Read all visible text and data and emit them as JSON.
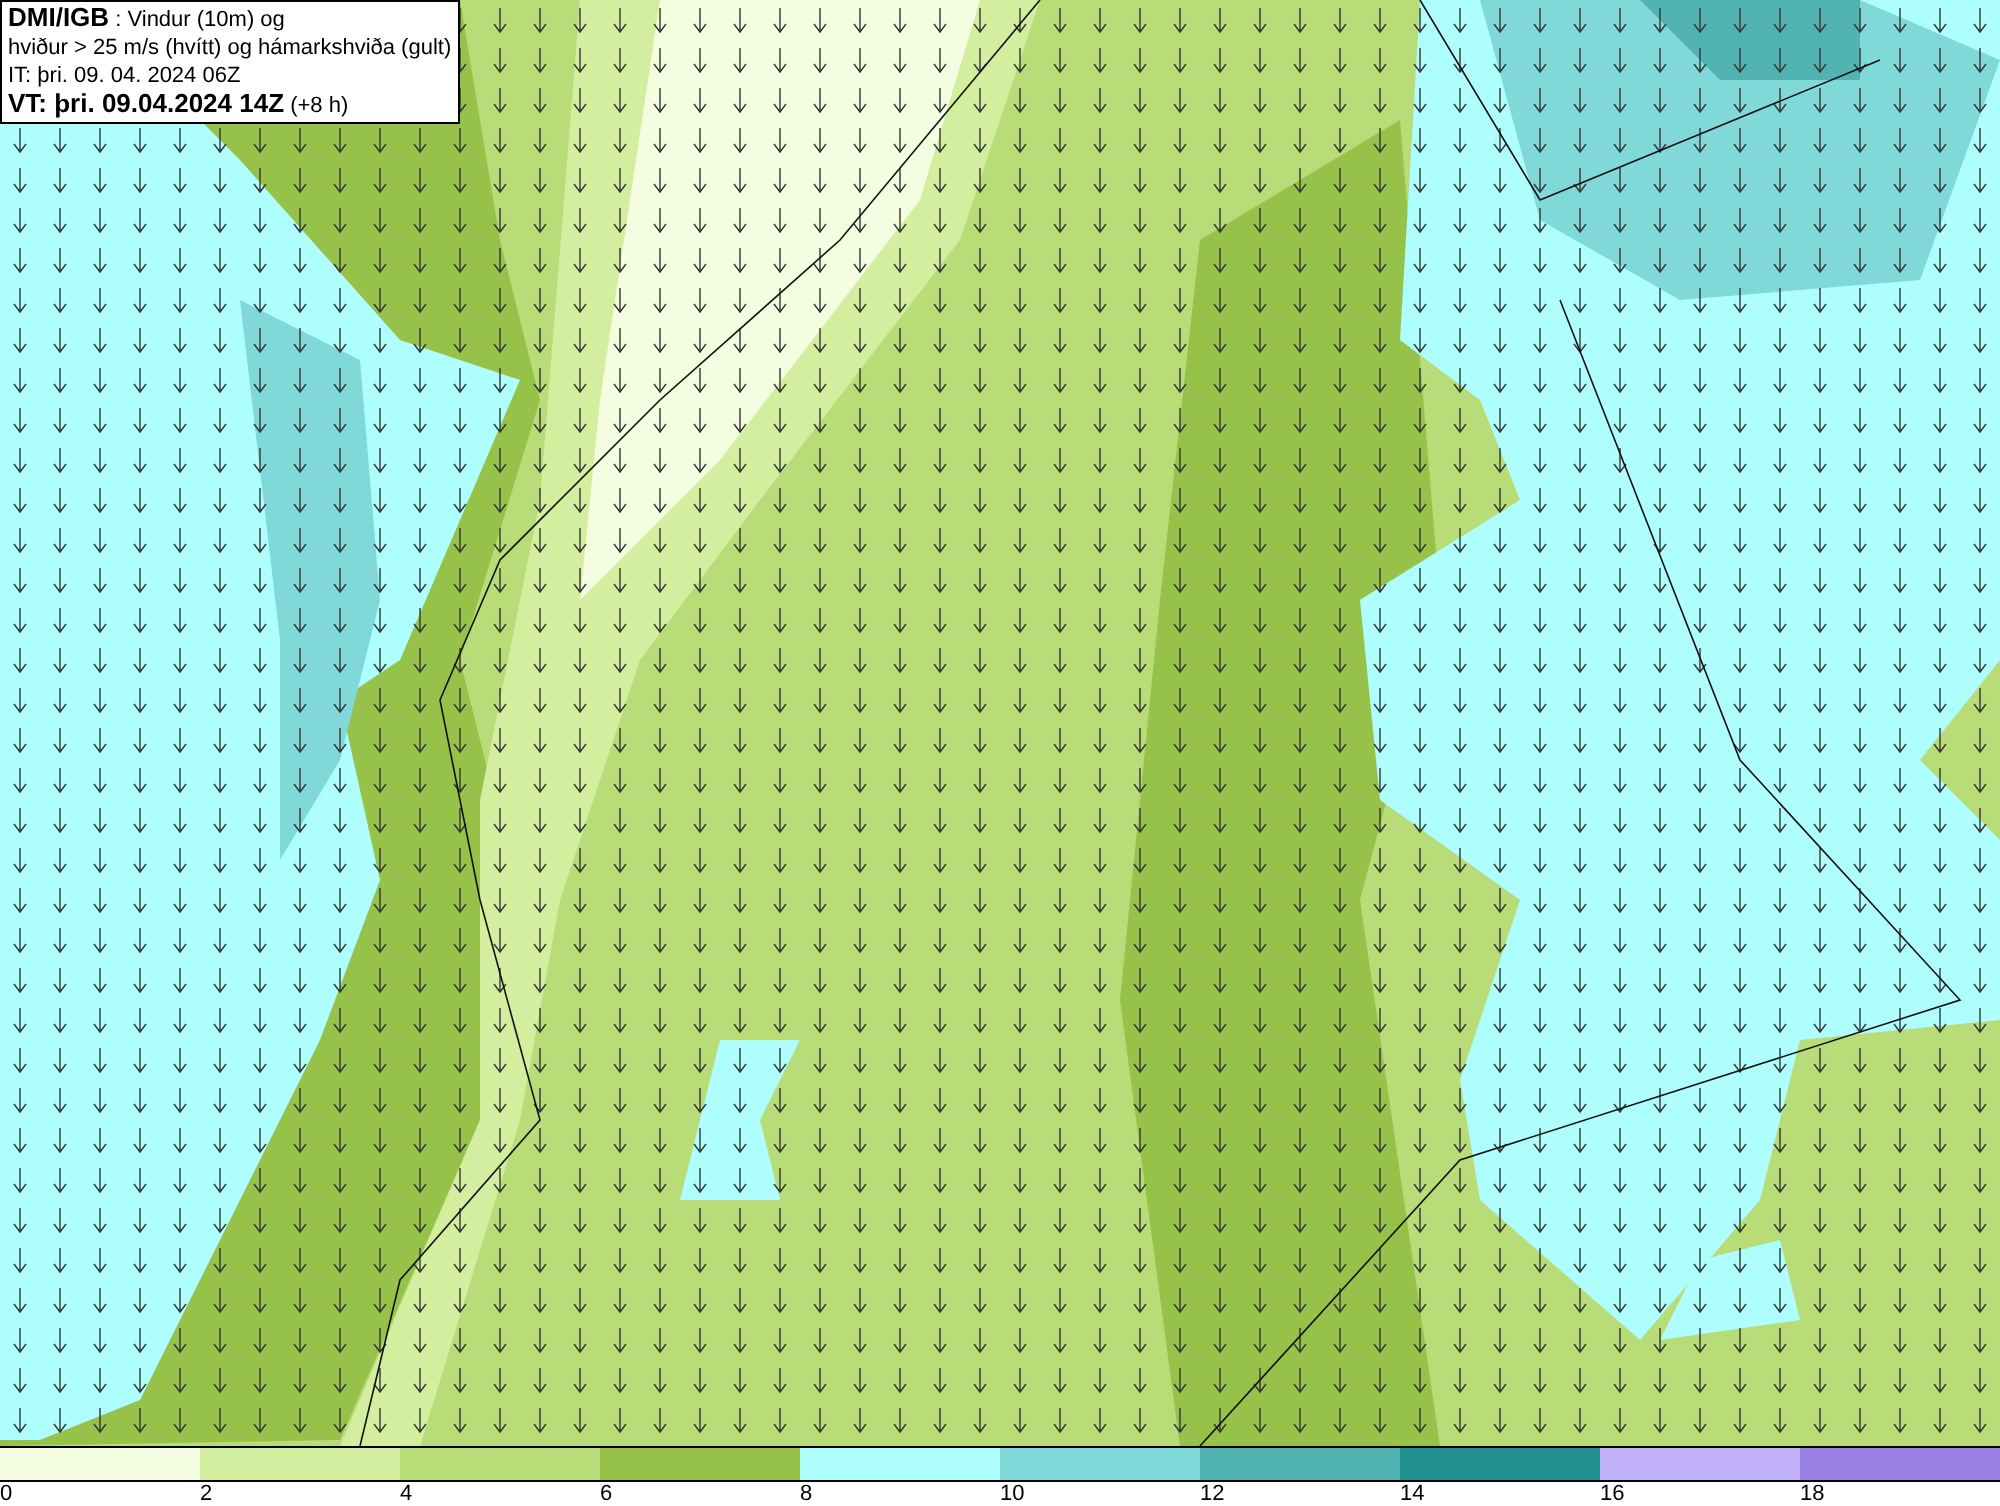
{
  "title_box": {
    "lines": [
      "**DMI/IGB** : Vindur (10m) og",
      "hviður > 25 m/s (hvítt) og hámarkshviða (gult)",
      "IT: þri. 09. 04. 2024 06Z",
      "**VT: þri. 09.04.2024 14Z** (+8 h)"
    ]
  },
  "legend": {
    "bins": [
      {
        "color": "#f5fde0"
      },
      {
        "color": "#d4eea0"
      },
      {
        "color": "#b7dc78"
      },
      {
        "color": "#97c24a"
      },
      {
        "color": "#aefefe"
      },
      {
        "color": "#80d8d8"
      },
      {
        "color": "#52b3b3"
      },
      {
        "color": "#219090"
      },
      {
        "color": "#c0b0f8"
      },
      {
        "color": "#9a80e0"
      }
    ],
    "ticks": [
      "0",
      "2",
      "4",
      "6",
      "8",
      "10",
      "12",
      "14",
      "16",
      "18"
    ]
  }
}
